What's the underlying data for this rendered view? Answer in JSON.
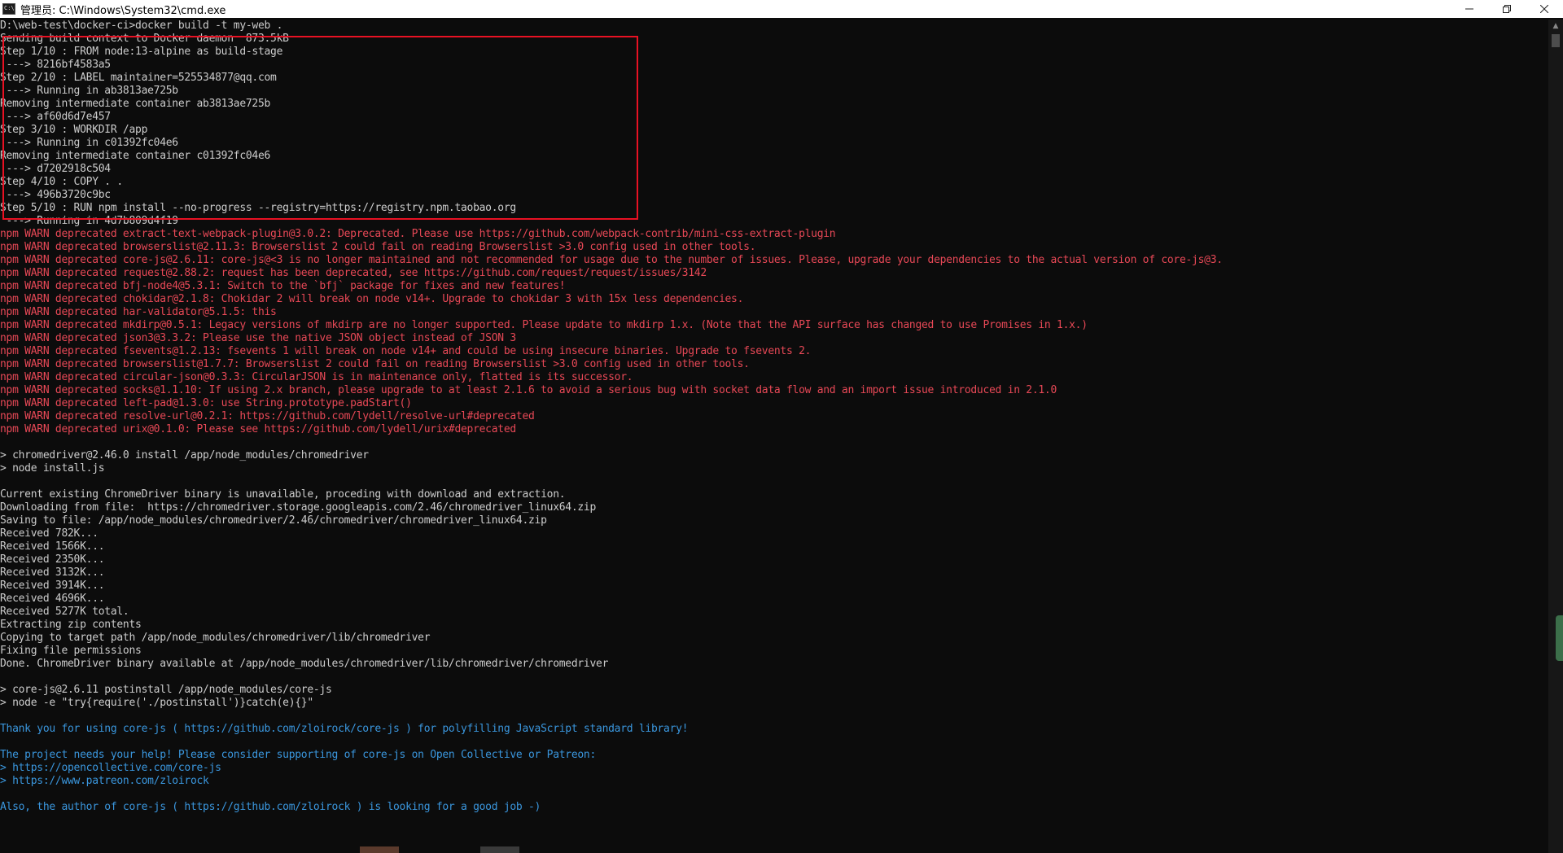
{
  "window": {
    "title": "管理员: C:\\Windows\\System32\\cmd.exe",
    "icon_label": "C:\\",
    "controls": {
      "minimize_icon": "minimize-icon",
      "restore_icon": "restore-icon",
      "close_icon": "close-icon"
    }
  },
  "colors": {
    "background": "#0c0c0c",
    "normal_text": "#cccccc",
    "warn_text": "#e74856",
    "info_text": "#3a96dd",
    "highlight_border": "#e81123"
  },
  "console": {
    "lines": [
      {
        "text": "D:\\web-test\\docker-ci>docker build -t my-web .",
        "type": "normal"
      },
      {
        "text": "Sending build context to Docker daemon  873.5kB",
        "type": "normal"
      },
      {
        "text": "Step 1/10 : FROM node:13-alpine as build-stage",
        "type": "normal"
      },
      {
        "text": " ---> 8216bf4583a5",
        "type": "normal"
      },
      {
        "text": "Step 2/10 : LABEL maintainer=525534877@qq.com",
        "type": "normal"
      },
      {
        "text": " ---> Running in ab3813ae725b",
        "type": "normal"
      },
      {
        "text": "Removing intermediate container ab3813ae725b",
        "type": "normal"
      },
      {
        "text": " ---> af60d6d7e457",
        "type": "normal"
      },
      {
        "text": "Step 3/10 : WORKDIR /app",
        "type": "normal"
      },
      {
        "text": " ---> Running in c01392fc04e6",
        "type": "normal"
      },
      {
        "text": "Removing intermediate container c01392fc04e6",
        "type": "normal"
      },
      {
        "text": " ---> d7202918c504",
        "type": "normal"
      },
      {
        "text": "Step 4/10 : COPY . .",
        "type": "normal"
      },
      {
        "text": " ---> 496b3720c9bc",
        "type": "normal"
      },
      {
        "text": "Step 5/10 : RUN npm install --no-progress --registry=https://registry.npm.taobao.org",
        "type": "normal"
      },
      {
        "text": " ---> Running in 4d7b809d4f19",
        "type": "normal"
      },
      {
        "text": "npm WARN deprecated extract-text-webpack-plugin@3.0.2: Deprecated. Please use https://github.com/webpack-contrib/mini-css-extract-plugin",
        "type": "warn"
      },
      {
        "text": "npm WARN deprecated browserslist@2.11.3: Browserslist 2 could fail on reading Browserslist >3.0 config used in other tools.",
        "type": "warn"
      },
      {
        "text": "npm WARN deprecated core-js@2.6.11: core-js@<3 is no longer maintained and not recommended for usage due to the number of issues. Please, upgrade your dependencies to the actual version of core-js@3.",
        "type": "warn"
      },
      {
        "text": "npm WARN deprecated request@2.88.2: request has been deprecated, see https://github.com/request/request/issues/3142",
        "type": "warn"
      },
      {
        "text": "npm WARN deprecated bfj-node4@5.3.1: Switch to the `bfj` package for fixes and new features!",
        "type": "warn"
      },
      {
        "text": "npm WARN deprecated chokidar@2.1.8: Chokidar 2 will break on node v14+. Upgrade to chokidar 3 with 15x less dependencies.",
        "type": "warn"
      },
      {
        "text": "npm WARN deprecated har-validator@5.1.5: this",
        "type": "warn"
      },
      {
        "text": "npm WARN deprecated mkdirp@0.5.1: Legacy versions of mkdirp are no longer supported. Please update to mkdirp 1.x. (Note that the API surface has changed to use Promises in 1.x.)",
        "type": "warn"
      },
      {
        "text": "npm WARN deprecated json3@3.3.2: Please use the native JSON object instead of JSON 3",
        "type": "warn"
      },
      {
        "text": "npm WARN deprecated fsevents@1.2.13: fsevents 1 will break on node v14+ and could be using insecure binaries. Upgrade to fsevents 2.",
        "type": "warn"
      },
      {
        "text": "npm WARN deprecated browserslist@1.7.7: Browserslist 2 could fail on reading Browserslist >3.0 config used in other tools.",
        "type": "warn"
      },
      {
        "text": "npm WARN deprecated circular-json@0.3.3: CircularJSON is in maintenance only, flatted is its successor.",
        "type": "warn"
      },
      {
        "text": "npm WARN deprecated socks@1.1.10: If using 2.x branch, please upgrade to at least 2.1.6 to avoid a serious bug with socket data flow and an import issue introduced in 2.1.0",
        "type": "warn"
      },
      {
        "text": "npm WARN deprecated left-pad@1.3.0: use String.prototype.padStart()",
        "type": "warn"
      },
      {
        "text": "npm WARN deprecated resolve-url@0.2.1: https://github.com/lydell/resolve-url#deprecated",
        "type": "warn"
      },
      {
        "text": "npm WARN deprecated urix@0.1.0: Please see https://github.com/lydell/urix#deprecated",
        "type": "warn"
      },
      {
        "text": "",
        "type": "normal"
      },
      {
        "text": "> chromedriver@2.46.0 install /app/node_modules/chromedriver",
        "type": "normal"
      },
      {
        "text": "> node install.js",
        "type": "normal"
      },
      {
        "text": "",
        "type": "normal"
      },
      {
        "text": "Current existing ChromeDriver binary is unavailable, proceding with download and extraction.",
        "type": "normal"
      },
      {
        "text": "Downloading from file:  https://chromedriver.storage.googleapis.com/2.46/chromedriver_linux64.zip",
        "type": "normal"
      },
      {
        "text": "Saving to file: /app/node_modules/chromedriver/2.46/chromedriver/chromedriver_linux64.zip",
        "type": "normal"
      },
      {
        "text": "Received 782K...",
        "type": "normal"
      },
      {
        "text": "Received 1566K...",
        "type": "normal"
      },
      {
        "text": "Received 2350K...",
        "type": "normal"
      },
      {
        "text": "Received 3132K...",
        "type": "normal"
      },
      {
        "text": "Received 3914K...",
        "type": "normal"
      },
      {
        "text": "Received 4696K...",
        "type": "normal"
      },
      {
        "text": "Received 5277K total.",
        "type": "normal"
      },
      {
        "text": "Extracting zip contents",
        "type": "normal"
      },
      {
        "text": "Copying to target path /app/node_modules/chromedriver/lib/chromedriver",
        "type": "normal"
      },
      {
        "text": "Fixing file permissions",
        "type": "normal"
      },
      {
        "text": "Done. ChromeDriver binary available at /app/node_modules/chromedriver/lib/chromedriver/chromedriver",
        "type": "normal"
      },
      {
        "text": "",
        "type": "normal"
      },
      {
        "text": "> core-js@2.6.11 postinstall /app/node_modules/core-js",
        "type": "normal"
      },
      {
        "text": "> node -e \"try{require('./postinstall')}catch(e){}\"",
        "type": "normal"
      },
      {
        "text": "",
        "type": "normal"
      },
      {
        "text": "Thank you for using core-js ( https://github.com/zloirock/core-js ) for polyfilling JavaScript standard library!",
        "type": "info"
      },
      {
        "text": "",
        "type": "normal"
      },
      {
        "text": "The project needs your help! Please consider supporting of core-js on Open Collective or Patreon:",
        "type": "info"
      },
      {
        "text": "> https://opencollective.com/core-js",
        "type": "info"
      },
      {
        "text": "> https://www.patreon.com/zloirock",
        "type": "info"
      },
      {
        "text": "",
        "type": "normal"
      },
      {
        "text": "Also, the author of core-js ( https://github.com/zloirock ) is looking for a good job -)",
        "type": "info"
      }
    ]
  },
  "scrollbar": {
    "up_arrow_icon": "scroll-up-icon",
    "down_arrow_icon": "scroll-down-icon"
  }
}
